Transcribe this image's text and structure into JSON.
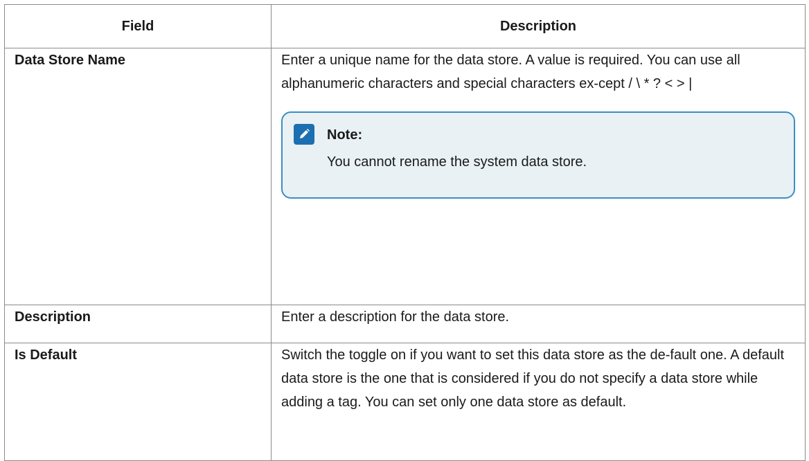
{
  "table": {
    "headers": {
      "field": "Field",
      "description": "Description"
    },
    "rows": [
      {
        "field": "Data Store Name",
        "description": "Enter a unique name for the data store. A value is required. You can use all alphanumeric characters and special characters ex-cept / \\ * ? < > |",
        "note": {
          "icon": "pencil-icon",
          "label": "Note:",
          "text": "You cannot rename the system data store."
        }
      },
      {
        "field": "Description",
        "description": "Enter a description for the data store."
      },
      {
        "field": "Is Default",
        "description": "Switch the toggle on if you want to set this data store as the de-fault one. A default data store is the one that is considered if you do not specify a data store while adding a tag. You can set only one data store as default."
      }
    ]
  }
}
